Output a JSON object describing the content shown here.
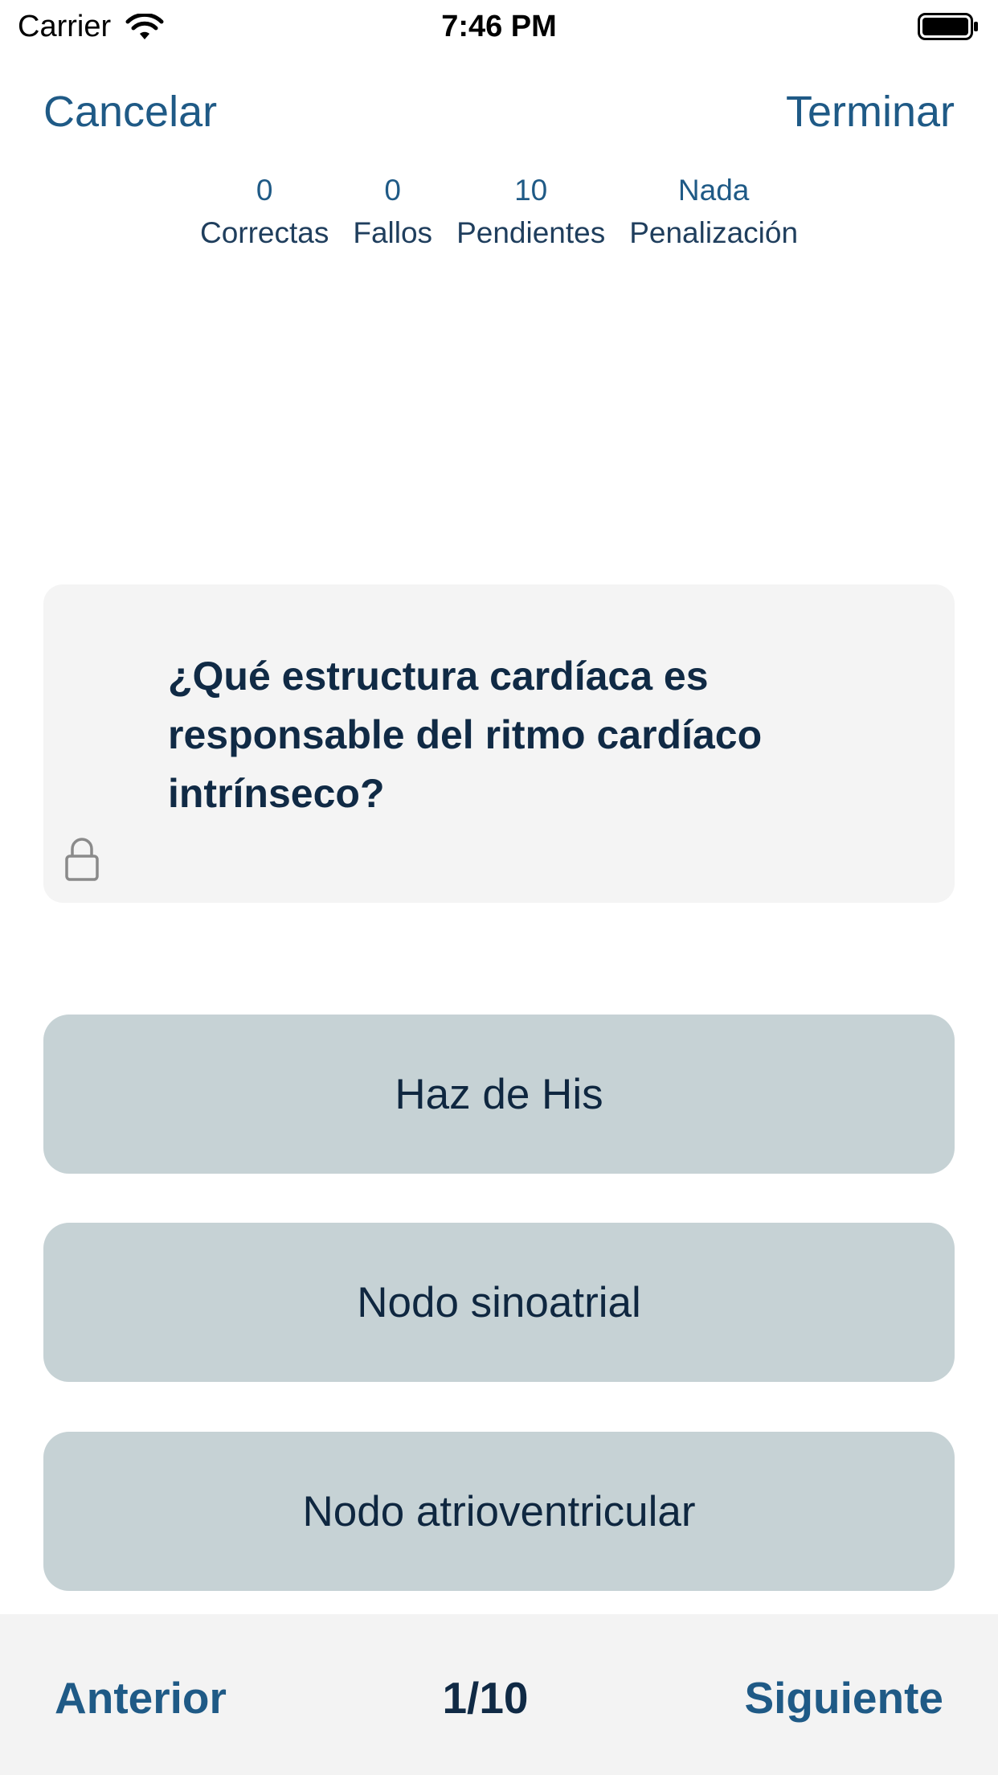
{
  "status_bar": {
    "carrier": "Carrier",
    "time": "7:46 PM",
    "wifi_icon": "wifi-icon",
    "battery_icon": "battery-icon"
  },
  "nav": {
    "cancel_label": "Cancelar",
    "finish_label": "Terminar"
  },
  "stats": [
    {
      "value": "0",
      "label": "Correctas"
    },
    {
      "value": "0",
      "label": "Fallos"
    },
    {
      "value": "10",
      "label": "Pendientes"
    },
    {
      "value": "Nada",
      "label": "Penalización"
    }
  ],
  "question": {
    "text": "¿Qué estructura cardíaca es responsable del ritmo cardíaco intrínseco?",
    "lock_icon": "lock-icon"
  },
  "answers": [
    {
      "label": "Haz de His"
    },
    {
      "label": "Nodo sinoatrial"
    },
    {
      "label": "Nodo atrioventricular"
    }
  ],
  "toolbar": {
    "prev_label": "Anterior",
    "page": "1/10",
    "next_label": "Siguiente"
  },
  "colors": {
    "accent": "#1f5a86",
    "text_dark": "#0f2740",
    "answer_bg": "#c6d2d5",
    "card_bg": "#f4f4f4",
    "toolbar_bg": "#f3f3f3"
  }
}
